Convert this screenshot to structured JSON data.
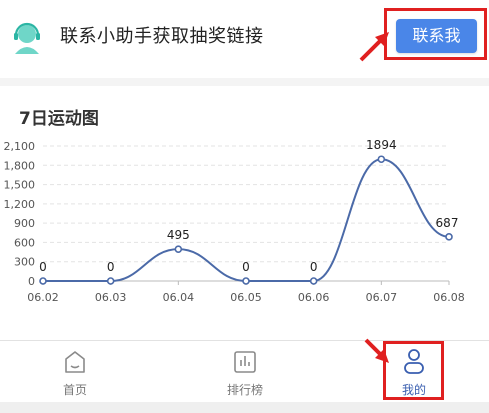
{
  "banner": {
    "text": "联系小助手获取抽奖链接",
    "button_label": "联系我",
    "avatar_icon": "headset-avatar-icon"
  },
  "card": {
    "title": "7日运动图"
  },
  "chart_data": {
    "type": "line",
    "title": "7日运动图",
    "categories": [
      "06.02",
      "06.03",
      "06.04",
      "06.05",
      "06.06",
      "06.07",
      "06.08"
    ],
    "series": [
      {
        "values": [
          0,
          0,
          495,
          0,
          0,
          1894,
          687
        ]
      }
    ],
    "data_labels": [
      "0",
      "0",
      "495",
      "0",
      "0",
      "1894",
      "687"
    ],
    "y_ticks": [
      "0",
      "300",
      "600",
      "900",
      "1,200",
      "1,500",
      "1,800",
      "2,100"
    ],
    "ylim": [
      0,
      2100
    ],
    "smooth": true,
    "grid": true,
    "line_color": "#4b6aa8"
  },
  "tabbar": {
    "tabs": [
      {
        "label": "首页",
        "icon": "home-icon"
      },
      {
        "label": "排行榜",
        "icon": "bar-chart-icon"
      },
      {
        "label": "我的",
        "icon": "user-icon",
        "active": true
      }
    ]
  },
  "colors": {
    "accent": "#4a86e8",
    "annotation_red": "#e02020",
    "active_tab": "#3a5fb0"
  }
}
